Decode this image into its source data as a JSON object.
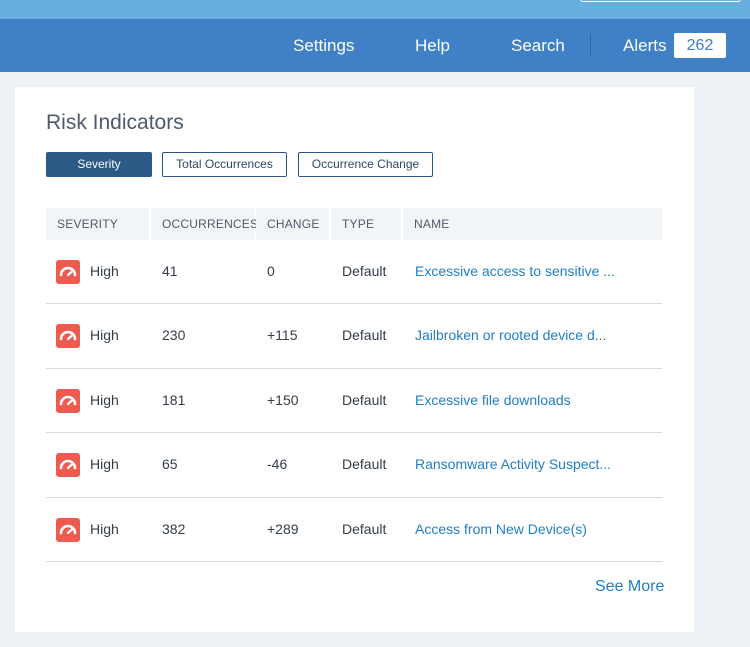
{
  "nav": {
    "settings": "Settings",
    "help": "Help",
    "search": "Search",
    "alerts": "Alerts",
    "alerts_count": "262"
  },
  "card": {
    "title": "Risk Indicators",
    "filters": [
      "Severity",
      "Total Occurrences",
      "Occurrence Change"
    ],
    "active_filter": "Severity",
    "columns": [
      "SEVERITY",
      "OCCURRENCES",
      "CHANGE",
      "TYPE",
      "NAME"
    ],
    "rows": [
      {
        "severity": "High",
        "occurrences": "41",
        "change": "0",
        "type": "Default",
        "name": "Excessive access to sensitive ..."
      },
      {
        "severity": "High",
        "occurrences": "230",
        "change": "+115",
        "type": "Default",
        "name": "Jailbroken or rooted device d..."
      },
      {
        "severity": "High",
        "occurrences": "181",
        "change": "+150",
        "type": "Default",
        "name": "Excessive file downloads"
      },
      {
        "severity": "High",
        "occurrences": "65",
        "change": "-46",
        "type": "Default",
        "name": "Ransomware Activity Suspect..."
      },
      {
        "severity": "High",
        "occurrences": "382",
        "change": "+289",
        "type": "Default",
        "name": "Access from New Device(s)"
      }
    ],
    "see_more": "See More"
  },
  "colors": {
    "topbar": "#67aee0",
    "navbar": "#3f80c6",
    "severity_high": "#ef5a4f",
    "link": "#1e7fc8",
    "active_button": "#2c5a86"
  },
  "icons": {
    "severity": "gauge-high-icon"
  }
}
